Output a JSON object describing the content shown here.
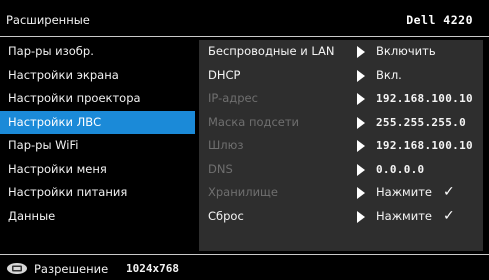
{
  "header": {
    "title": "Расширенные",
    "model": "Dell 4220"
  },
  "left_menu": {
    "items": [
      {
        "label": "Пар-ры изобр."
      },
      {
        "label": "Настройки экрана"
      },
      {
        "label": "Настройки проектора"
      },
      {
        "label": "Настройки ЛВС",
        "selected": true
      },
      {
        "label": "Пар-ры WiFi"
      },
      {
        "label": "Настройки меня"
      },
      {
        "label": "Настройки питания"
      },
      {
        "label": "Данные"
      }
    ]
  },
  "panel": {
    "rows": [
      {
        "label": "Беспроводные и LAN",
        "value": "Включить",
        "enabled": true
      },
      {
        "label": "DHCP",
        "value": "Вкл.",
        "enabled": true
      },
      {
        "label": "IP-адрес",
        "value": "192.168.100.10",
        "enabled": false
      },
      {
        "label": "Маска подсети",
        "value": "255.255.255.0",
        "enabled": false
      },
      {
        "label": "Шлюз",
        "value": "192.168.100.10",
        "enabled": false
      },
      {
        "label": "DNS",
        "value": "0.0.0.0",
        "enabled": false
      },
      {
        "label": "Хранилище",
        "value": "Нажмите",
        "check": "✓",
        "enabled": false
      },
      {
        "label": "Сброс",
        "value": "Нажмите",
        "check": "✓",
        "enabled": true
      }
    ]
  },
  "status": {
    "label": "Разрешение",
    "value": "1024x768",
    "icon": "signal-source-icon"
  },
  "colors": {
    "selected": "#1b8ad8",
    "panel": "#2e2e2e",
    "disabled_text": "#6f6f6f",
    "background": "#000000"
  }
}
